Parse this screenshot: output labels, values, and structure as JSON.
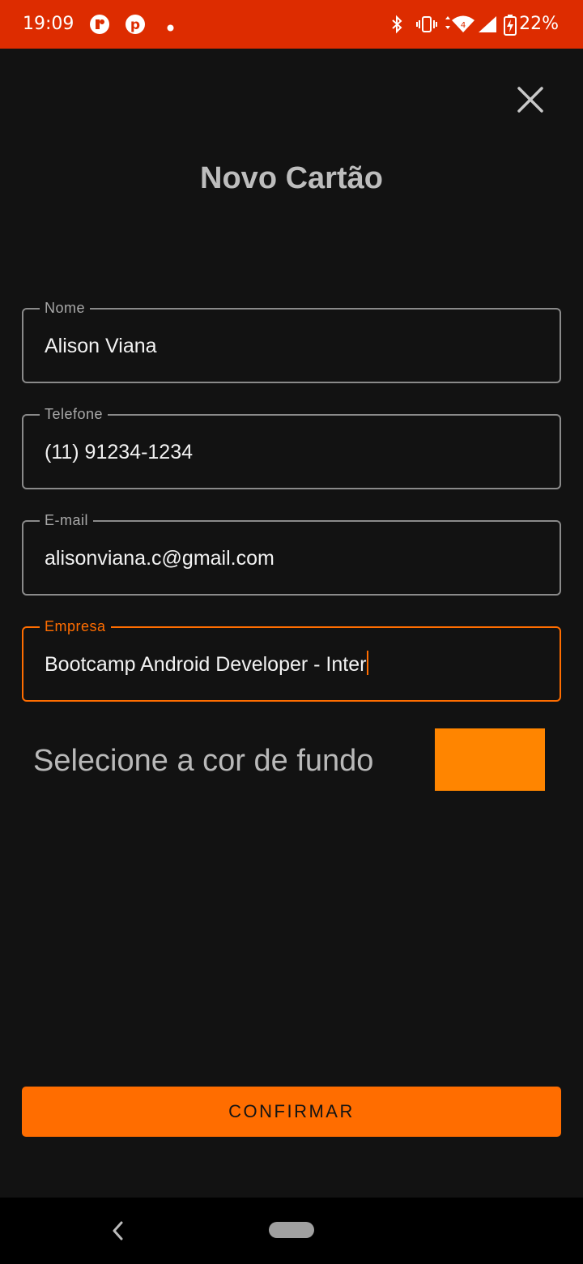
{
  "status_bar": {
    "time": "19:09",
    "battery": "22%",
    "icons": [
      "notification-app-icon",
      "pinterest-icon",
      "dot-icon",
      "bluetooth-icon",
      "vibrate-icon",
      "wifi-icon",
      "signal-icon",
      "battery-charging-icon"
    ]
  },
  "header": {
    "title": "Novo Cartão",
    "close_icon": "close-icon"
  },
  "form": {
    "nome": {
      "label": "Nome",
      "value": "Alison Viana"
    },
    "telefone": {
      "label": "Telefone",
      "value": "(11) 91234-1234"
    },
    "email": {
      "label": "E-mail",
      "value": "alisonviana.c@gmail.com"
    },
    "empresa": {
      "label": "Empresa",
      "value": "Bootcamp Android Developer - Inter"
    }
  },
  "color_picker": {
    "label": "Selecione a cor de fundo",
    "selected_color": "#ff8500"
  },
  "confirm_label": "CONFIRMAR",
  "colors": {
    "accent": "#ff6d00",
    "status_bar": "#dd2c00",
    "background": "#121212"
  },
  "nav_bar": {
    "icons": [
      "back-icon",
      "home-pill-icon"
    ]
  }
}
